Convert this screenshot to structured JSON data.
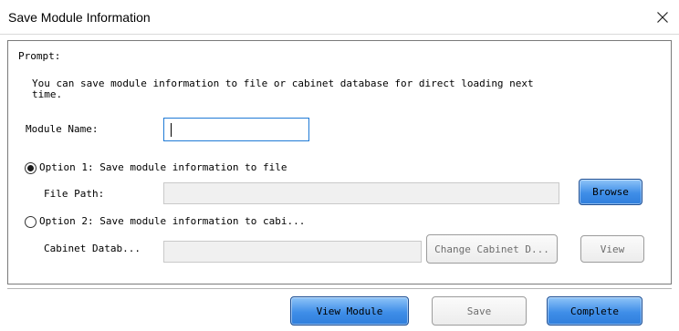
{
  "window": {
    "title": "Save Module Information",
    "close_symbol": "×"
  },
  "prompt": {
    "title": "Prompt:",
    "text": "You can save module information to file or cabinet database for direct loading next\ntime."
  },
  "module_name": {
    "label": "Module Name:",
    "value": ""
  },
  "option1": {
    "label": "Option 1: Save module information to file",
    "selected": true
  },
  "file_path": {
    "label": "File Path:",
    "value": "",
    "browse_label": "Browse"
  },
  "option2": {
    "label": "Option 2: Save module information to cabi...",
    "selected": false
  },
  "cabinet": {
    "label": "Cabinet Datab...",
    "value": "",
    "change_label": "Change Cabinet D...",
    "view_label": "View"
  },
  "footer": {
    "view_module_label": "View Module",
    "save_label": "Save",
    "complete_label": "Complete"
  },
  "colors": {
    "accent_button": "#3f8ee8",
    "focus_border": "#1f7ad6"
  }
}
